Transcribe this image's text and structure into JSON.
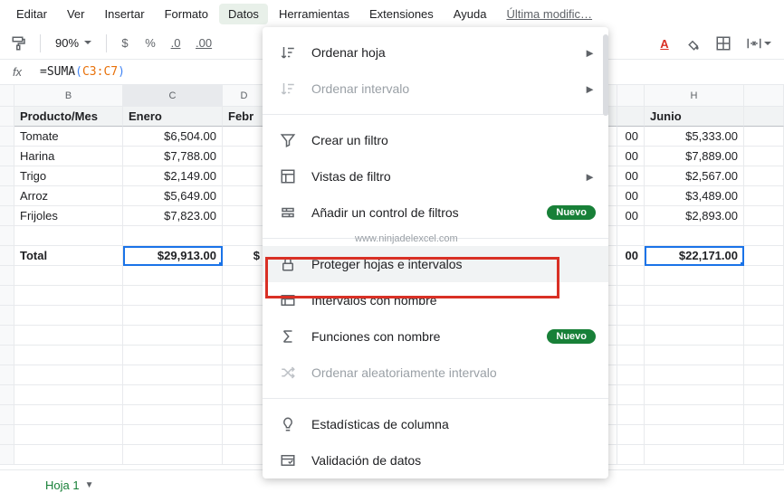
{
  "menubar": [
    "Editar",
    "Ver",
    "Insertar",
    "Formato",
    "Datos",
    "Herramientas",
    "Extensiones",
    "Ayuda"
  ],
  "menubar_mod": "Última modific…",
  "toolbar": {
    "zoom": "90%",
    "currency": "$",
    "percent": "%",
    "dec_less": ".0",
    "dec_more": ".00"
  },
  "formula": {
    "eq": "=",
    "fn": "SUMA",
    "open": "(",
    "range": "C3:C7",
    "close": ")"
  },
  "columns": {
    "B": "B",
    "C": "C",
    "D": "D",
    "H": "H"
  },
  "table": {
    "headers": {
      "producto": "Producto/Mes",
      "enero": "Enero",
      "febr": "Febr",
      "junio": "Junio"
    },
    "rows": [
      {
        "p": "Tomate",
        "c": "$6,504.00",
        "g": "00",
        "h": "$5,333.00"
      },
      {
        "p": "Harina",
        "c": "$7,788.00",
        "g": "00",
        "h": "$7,889.00"
      },
      {
        "p": "Trigo",
        "c": "$2,149.00",
        "g": "00",
        "h": "$2,567.00"
      },
      {
        "p": "Arroz",
        "c": "$5,649.00",
        "g": "00",
        "h": "$3,489.00"
      },
      {
        "p": "Frijoles",
        "c": "$7,823.00",
        "g": "00",
        "h": "$2,893.00"
      }
    ],
    "total": {
      "label": "Total",
      "c": "$29,913.00",
      "d": "$",
      "g": "00",
      "h": "$22,171.00"
    }
  },
  "dropdown": {
    "items": [
      {
        "id": "sort-sheet",
        "label": "Ordenar hoja",
        "icon": "sort",
        "arrow": true
      },
      {
        "id": "sort-range",
        "label": "Ordenar intervalo",
        "icon": "sort",
        "arrow": true,
        "disabled": true
      },
      {
        "sep": true
      },
      {
        "id": "create-filter",
        "label": "Crear un filtro",
        "icon": "funnel"
      },
      {
        "id": "filter-views",
        "label": "Vistas de filtro",
        "icon": "filterview",
        "arrow": true
      },
      {
        "id": "add-slicer",
        "label": "Añadir un control de filtros",
        "icon": "slicer",
        "badge": "Nuevo"
      },
      {
        "sep": true
      },
      {
        "id": "protect",
        "label": "Proteger hojas e intervalos",
        "icon": "lock",
        "hover": true
      },
      {
        "id": "named-ranges",
        "label": "Intervalos con nombre",
        "icon": "named"
      },
      {
        "id": "named-functions",
        "label": "Funciones con nombre",
        "icon": "sigma",
        "badge": "Nuevo"
      },
      {
        "id": "randomize",
        "label": "Ordenar aleatoriamente intervalo",
        "icon": "shuffle",
        "disabled": true
      },
      {
        "sep": true
      },
      {
        "id": "col-stats",
        "label": "Estadísticas de columna",
        "icon": "bulb"
      },
      {
        "id": "validation",
        "label": "Validación de datos",
        "icon": "validation"
      }
    ]
  },
  "watermark": "www.ninjadelexcel.com",
  "sheettab": "Hoja 1",
  "chart_data": {
    "type": "table",
    "title": "Producto/Mes",
    "columns": [
      "Producto/Mes",
      "Enero",
      "Junio"
    ],
    "rows": [
      [
        "Tomate",
        6504.0,
        5333.0
      ],
      [
        "Harina",
        7788.0,
        7889.0
      ],
      [
        "Trigo",
        2149.0,
        2567.0
      ],
      [
        "Arroz",
        5649.0,
        3489.0
      ],
      [
        "Frijoles",
        7823.0,
        2893.0
      ],
      [
        "Total",
        29913.0,
        22171.0
      ]
    ]
  }
}
